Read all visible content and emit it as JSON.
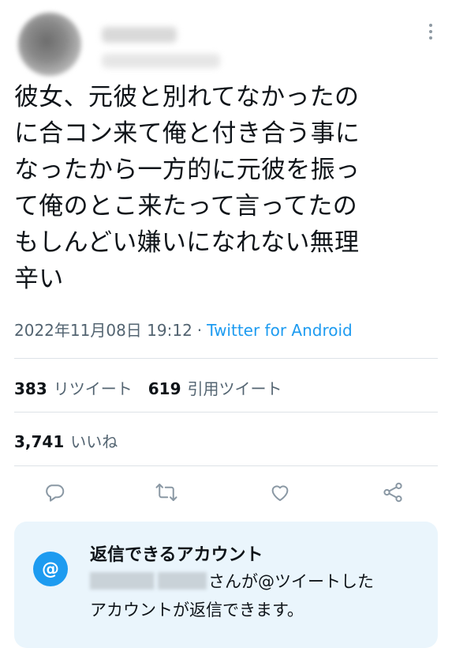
{
  "tweet": {
    "text": "彼女、元彼と別れてなかったの\nに合コン来て俺と付き合う事に\nなったから一方的に元彼を振っ\nて俺のとこ来たって言ってたの\nもしんどい嫌いになれない無理\n辛い",
    "timestamp": "2022年11月08日 19:12",
    "separator": "·",
    "source": "Twitter for Android"
  },
  "stats": {
    "retweets": {
      "count": "383",
      "label": "リツイート"
    },
    "quotes": {
      "count": "619",
      "label": "引用ツイート"
    },
    "likes": {
      "count": "3,741",
      "label": "いいね"
    }
  },
  "actions": [
    "reply-icon",
    "retweet-icon",
    "like-icon",
    "share-icon"
  ],
  "reply_card": {
    "icon_glyph": "@",
    "title": "返信できるアカウント",
    "line1": "さんが@ツイートした",
    "line2": "アカウントが返信できます。"
  },
  "colors": {
    "accent": "#1d9bf0",
    "secondary_text": "#536471",
    "divider": "#dde3e7",
    "card_bg": "#eaf5fc"
  }
}
